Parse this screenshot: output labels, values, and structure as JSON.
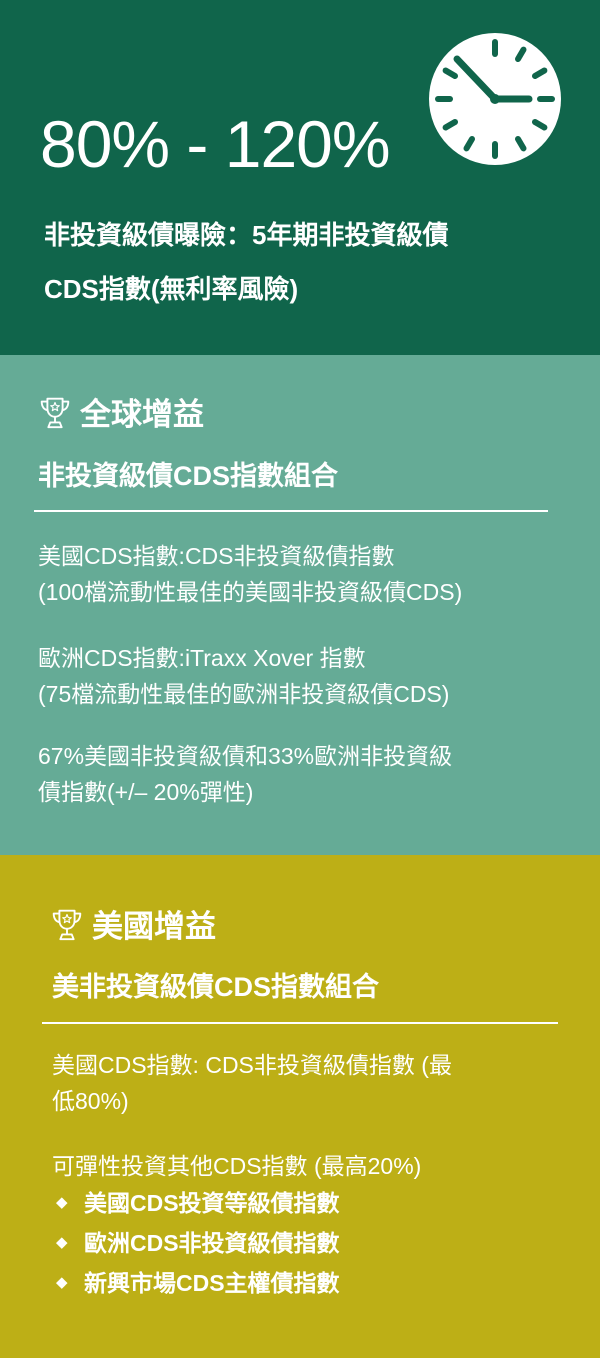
{
  "top": {
    "range": "80% - 120%",
    "line1": "非投資級債曝險：5年期非投資級債",
    "line2": "CDS指數(無利率風險)"
  },
  "global": {
    "heading": "全球增益",
    "subheading": "非投資級債CDS指數組合",
    "p1_line1": "美國CDS指數:CDS非投資級債指數",
    "p1_line2": "(100檔流動性最佳的美國非投資級債CDS)",
    "p2_line1": "歐洲CDS指數:iTraxx Xover 指數",
    "p2_line2": "(75檔流動性最佳的歐洲非投資級債CDS)",
    "p3_line1": "67%美國非投資級債和33%歐洲非投資級",
    "p3_line2": "債指數(+/– 20%彈性)"
  },
  "us": {
    "heading": "美國增益",
    "subheading": "美非投資級債CDS指數組合",
    "p1_line1": "美國CDS指數: CDS非投資級債指數 (最",
    "p1_line2": "低80%)",
    "p2": "可彈性投資其他CDS指數 (最高20%)",
    "bullets": [
      "美國CDS投資等級債指數",
      "歐洲CDS非投資級債指數",
      "新興市場CDS主權債指數"
    ]
  }
}
